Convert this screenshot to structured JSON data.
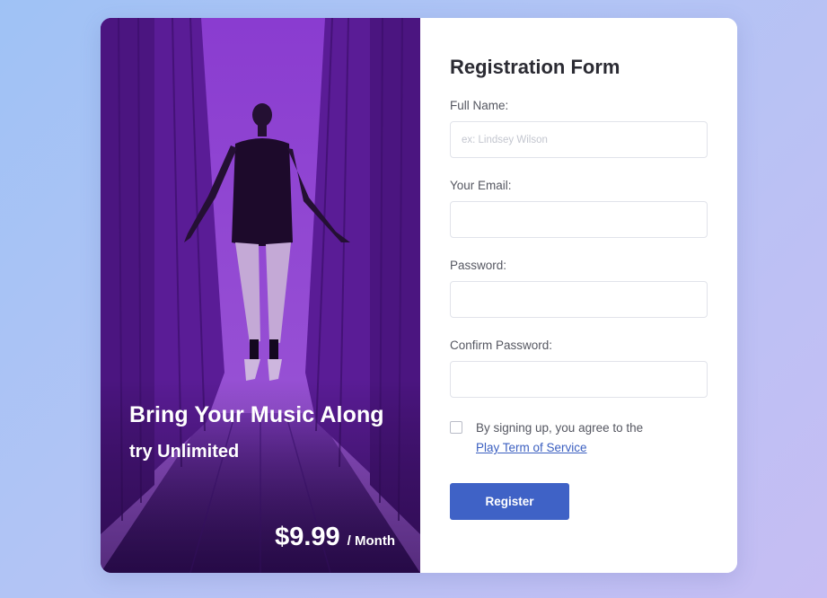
{
  "promo": {
    "headline": "Bring Your Music Along",
    "subheadline": "try Unlimited",
    "price": "$9.99",
    "period": "/ Month"
  },
  "form": {
    "title": "Registration Form",
    "full_name": {
      "label": "Full Name:",
      "placeholder": "ex: Lindsey Wilson",
      "value": ""
    },
    "email": {
      "label": "Your Email:",
      "placeholder": "",
      "value": ""
    },
    "password": {
      "label": "Password:",
      "placeholder": "",
      "value": ""
    },
    "confirm_password": {
      "label": "Confirm Password:",
      "placeholder": "",
      "value": ""
    },
    "terms": {
      "checked": false,
      "text": "By signing up, you agree to the",
      "link": "Play Term of Service"
    },
    "submit_label": "Register"
  },
  "colors": {
    "accent": "#3f62c6",
    "promo_overlay": "#6a22ae",
    "background_start": "#9fc2f5",
    "background_end": "#c6bdf3"
  }
}
